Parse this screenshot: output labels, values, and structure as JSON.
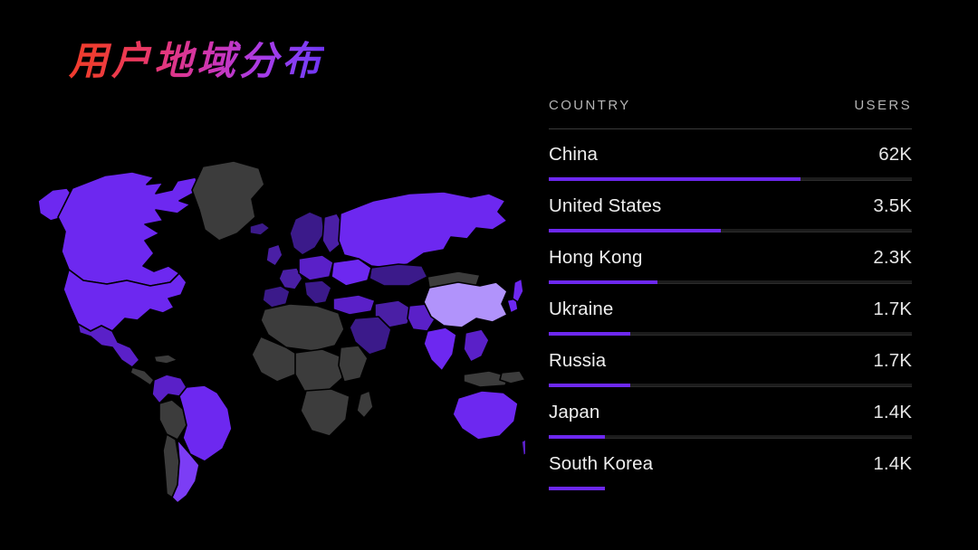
{
  "page": {
    "title": "用户地域分布",
    "background": "#000000",
    "accent": "#6d28f0",
    "title_gradient_from": "#f03b2e",
    "title_gradient_to": "#6d2ff2"
  },
  "table": {
    "headers": {
      "country": "COUNTRY",
      "users": "USERS"
    },
    "rows": [
      {
        "country": "China",
        "users": "62K",
        "bar_pct": 69.3
      },
      {
        "country": "United States",
        "users": "3.5K",
        "bar_pct": 47.4
      },
      {
        "country": "Hong Kong",
        "users": "2.3K",
        "bar_pct": 30.0
      },
      {
        "country": "Ukraine",
        "users": "1.7K",
        "bar_pct": 22.4
      },
      {
        "country": "Russia",
        "users": "1.7K",
        "bar_pct": 22.4
      },
      {
        "country": "Japan",
        "users": "1.4K",
        "bar_pct": 15.5
      },
      {
        "country": "South Korea",
        "users": "1.4K",
        "bar_pct": 15.5
      }
    ]
  },
  "chart_data": {
    "type": "bar",
    "title": "用户地域分布",
    "categories": [
      "China",
      "United States",
      "Hong Kong",
      "Ukraine",
      "Russia",
      "Japan",
      "South Korea"
    ],
    "values": [
      62000,
      3500,
      2300,
      1700,
      1700,
      1400,
      1400
    ],
    "value_labels": [
      "62K",
      "3.5K",
      "2.3K",
      "1.7K",
      "1.7K",
      "1.4K",
      "1.4K"
    ],
    "xlabel": "COUNTRY",
    "ylabel": "USERS",
    "legend": "none",
    "grid": false,
    "companion_map": {
      "type": "choropleth",
      "projection": "equirectangular",
      "no_data_color": "#3c3c3c",
      "scale_low": "#3b1a8a",
      "scale_mid": "#6d28f0",
      "scale_high": "#b193fb",
      "highlighted_regions": [
        {
          "name": "China",
          "shade": "high"
        },
        {
          "name": "Russia",
          "shade": "mid"
        },
        {
          "name": "United States",
          "shade": "mid"
        },
        {
          "name": "Canada",
          "shade": "mid"
        },
        {
          "name": "Australia",
          "shade": "mid"
        },
        {
          "name": "Brazil",
          "shade": "mid"
        },
        {
          "name": "Argentina",
          "shade": "mid"
        },
        {
          "name": "India",
          "shade": "mid"
        },
        {
          "name": "Japan",
          "shade": "mid"
        },
        {
          "name": "Europe",
          "shade": "low"
        },
        {
          "name": "Africa",
          "shade": "none"
        },
        {
          "name": "Greenland",
          "shade": "none"
        }
      ]
    }
  }
}
